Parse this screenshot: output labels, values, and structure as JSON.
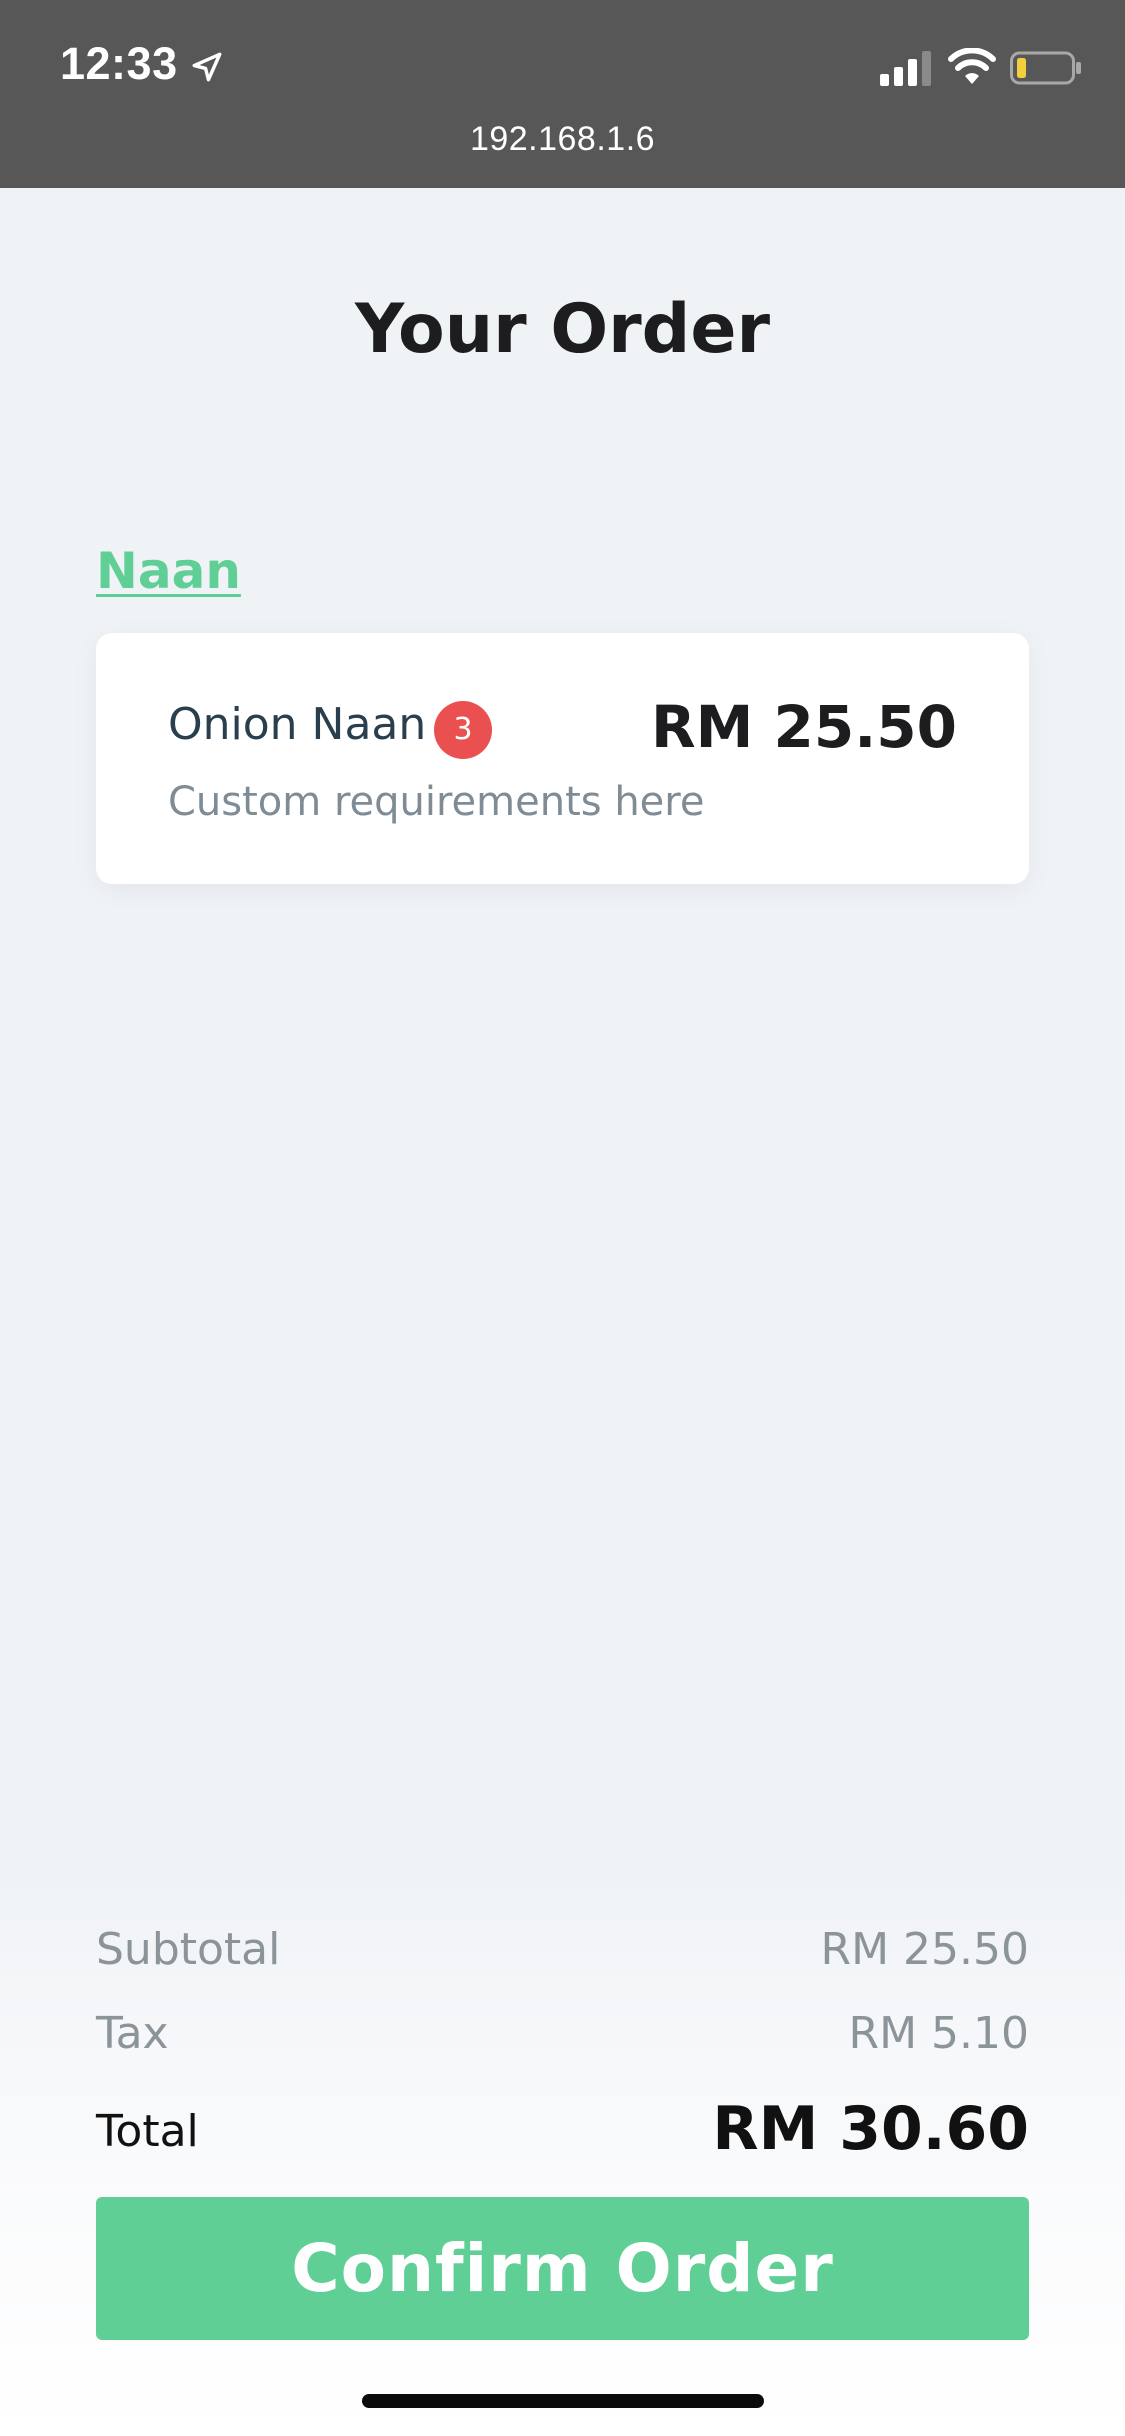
{
  "status_bar": {
    "time": "12:33",
    "location_icon": "location-arrow-icon",
    "signal_icon": "cellular-signal-icon",
    "wifi_icon": "wifi-icon",
    "battery_icon": "battery-low-icon",
    "url": "192.168.1.6"
  },
  "page": {
    "title": "Your Order"
  },
  "order": {
    "categories": [
      {
        "name": "Naan",
        "items": [
          {
            "name": "Onion Naan",
            "quantity": "3",
            "price": "RM 25.50",
            "note": "Custom requirements here"
          }
        ]
      }
    ]
  },
  "summary": {
    "subtotal_label": "Subtotal",
    "subtotal_value": "RM 25.50",
    "tax_label": "Tax",
    "tax_value": "RM 5.10",
    "total_label": "Total",
    "total_value": "RM 30.60"
  },
  "actions": {
    "confirm_label": "Confirm Order"
  },
  "colors": {
    "accent": "#5fcf95",
    "badge": "#ea5050",
    "status_bar": "#575757",
    "background": "#f0f3f6"
  }
}
